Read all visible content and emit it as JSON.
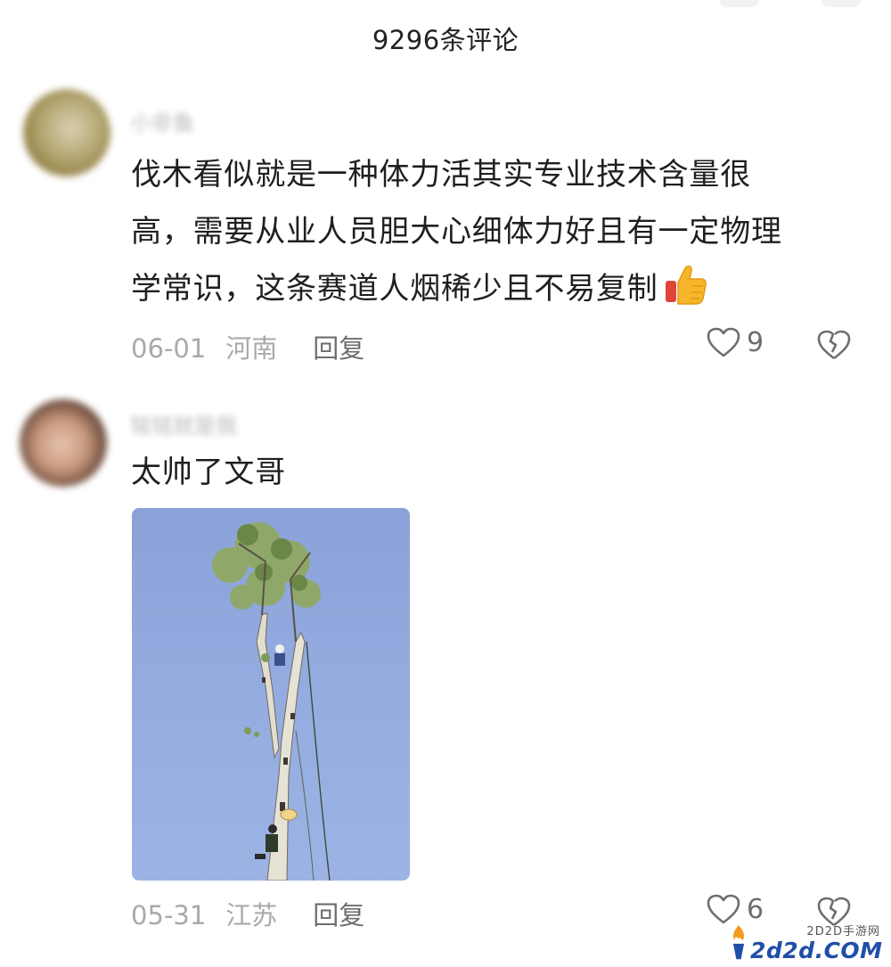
{
  "header": {
    "title": "9296条评论"
  },
  "comments": [
    {
      "username": "小非鱼",
      "text_lines": [
        "伐木看似就是一种体力活其实专业技术含量很",
        "高，需要从业人员胆大心细体力好且有一定物理",
        "学常识，这条赛道人烟稀少且不易复制"
      ],
      "emoji": "thumbs-up",
      "date": "06-01",
      "location": "河南",
      "reply_label": "回复",
      "likes": "9"
    },
    {
      "username": "铭铭就是我",
      "text_lines": [
        "太帅了文哥"
      ],
      "has_image": true,
      "date": "05-31",
      "location": "江苏",
      "reply_label": "回复",
      "likes": "6"
    }
  ],
  "watermark": {
    "cn": "2D2D手游网",
    "en": "2d2d.COM"
  },
  "colors": {
    "text": "#1f1f1f",
    "meta": "#a9a9a9",
    "icon": "#6e6e6e",
    "sky": "#93abdf",
    "wm_blue": "#1f4fa8"
  }
}
